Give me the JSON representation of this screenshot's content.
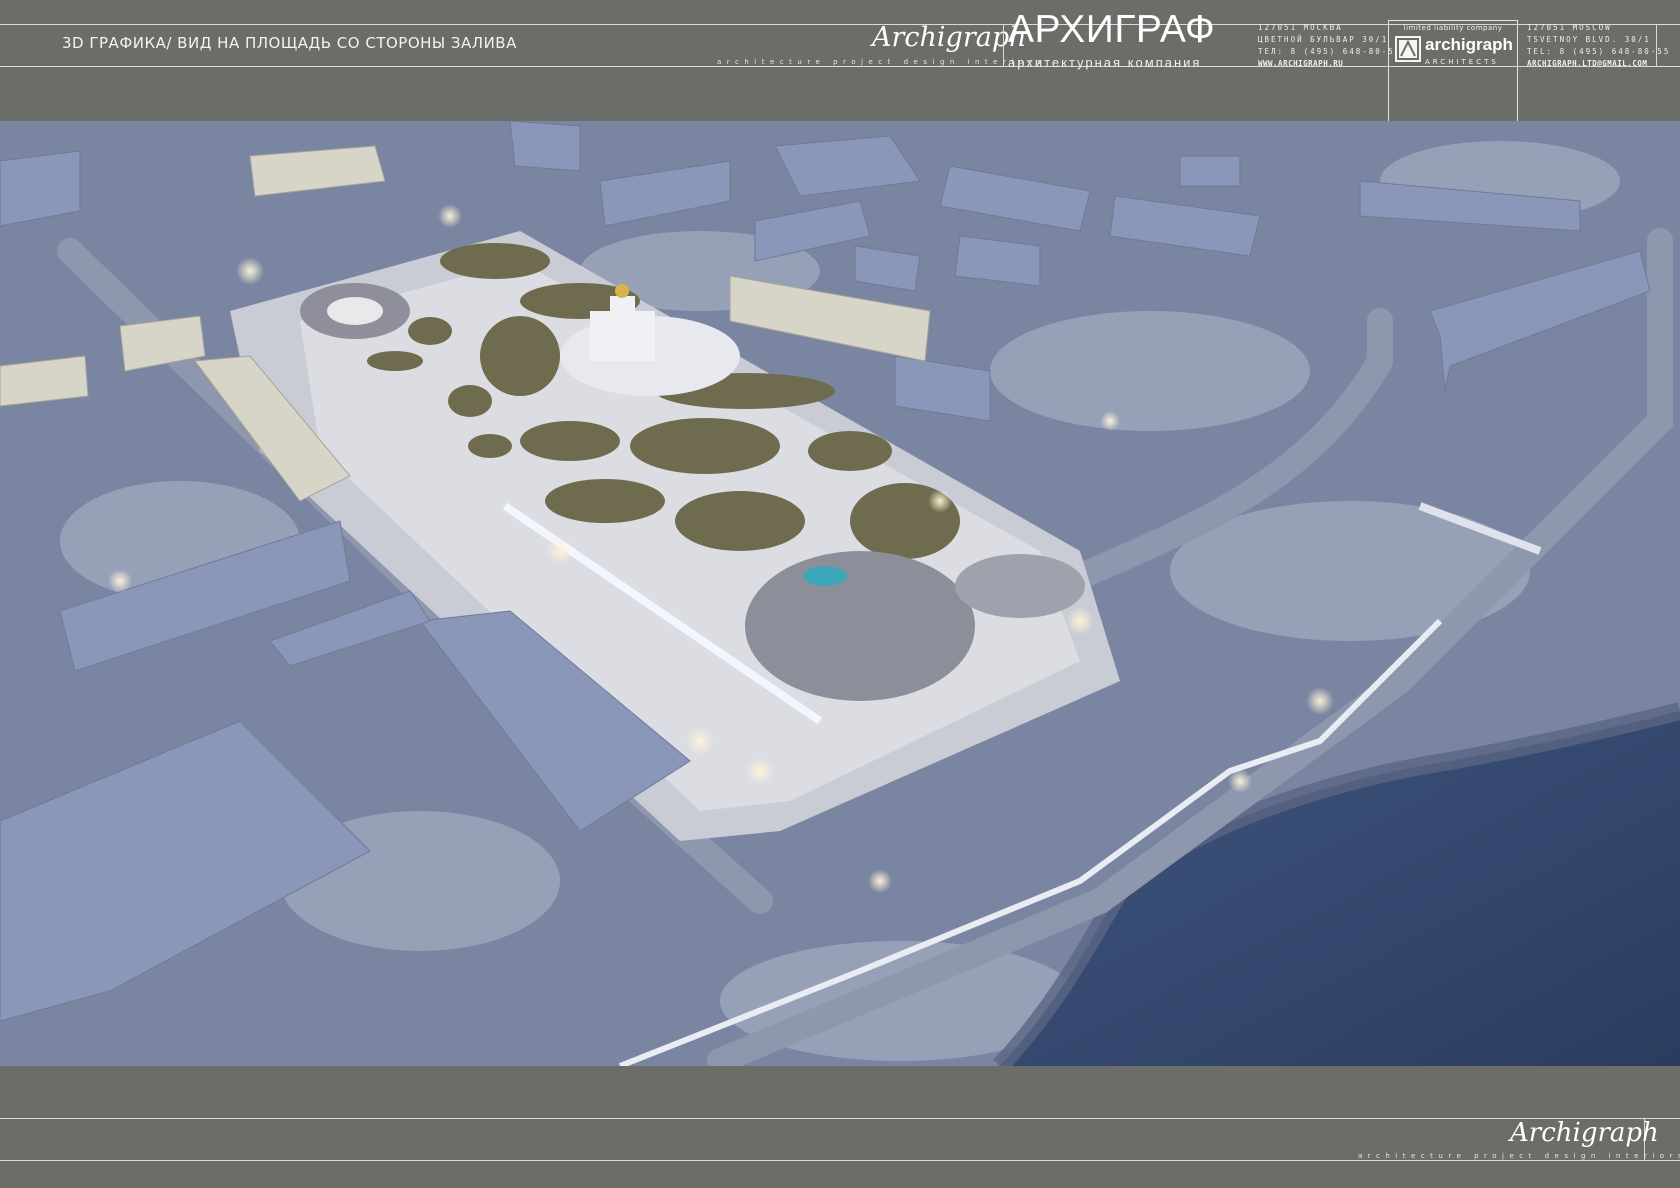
{
  "header": {
    "title": "3D ГРАФИКА/ ВИД НА ПЛОЩАДЬ СО СТОРОНЫ ЗАЛИВА",
    "script_logo": "Archigraph",
    "tagline": "architecture project design interiors",
    "brand_ru": "АРХИГРАФ",
    "brand_sub": "архитектурная компания",
    "address_ru": [
      "127051 МОСКВА",
      "ЦВЕТНОЙ БУЛЬВАР 30/1",
      "ТЕЛ: 8 (495) 648-80-55",
      "WWW.ARCHIGRAPH.RU"
    ],
    "logo_llc": "limited liability company",
    "logo_name": "archigraph",
    "logo_architects": "ARCHITECTS",
    "address_en": [
      "127051 MOSCOW",
      "TSVETNOY BLVD. 30/1",
      "TEL: 8 (495) 648-80-55",
      "ARCHIGRAPH.LTD@GMAIL.COM"
    ]
  },
  "footer": {
    "script_logo": "Archigraph",
    "tagline": "architecture project design interiors"
  },
  "colors": {
    "frame": "#6b6d68",
    "line": "#d9dcd6",
    "ground_snow": "#7d8aa6",
    "sea": "#3b4f74",
    "plaza": "#dcdde2"
  },
  "render": {
    "alt": "aerial night rendering of a city square by the bay"
  }
}
